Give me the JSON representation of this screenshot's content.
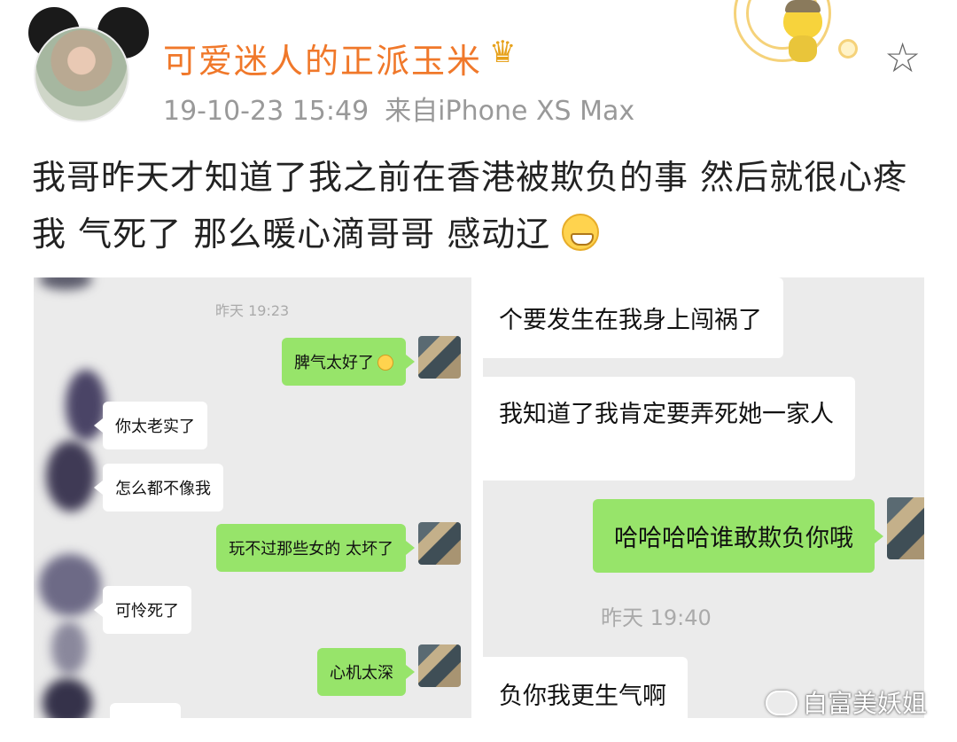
{
  "header": {
    "username": "可爱迷人的正派玉米",
    "crown_glyph": "♛",
    "time": "19-10-23 15:49",
    "source": "来自iPhone XS Max",
    "star_icon": "star-outline-icon"
  },
  "post": {
    "text": "我哥昨天才知道了我之前在香港被欺负的事 然后就很心疼我 气死了 那么暖心滴哥哥 感动辽",
    "emoji": "grin-emoji"
  },
  "left_chat": {
    "timestamp": "昨天 19:23",
    "messages": [
      {
        "side": "right",
        "text": "脾气太好了"
      },
      {
        "side": "left",
        "text": "你太老实了"
      },
      {
        "side": "left",
        "text": "怎么都不像我"
      },
      {
        "side": "right",
        "text": "玩不过那些女的 太坏了"
      },
      {
        "side": "left",
        "text": "可怜死了"
      },
      {
        "side": "right",
        "text": "心机太深"
      }
    ]
  },
  "right_chat": {
    "messages": [
      {
        "side": "left",
        "text": "个要发生在我身上闯祸了"
      },
      {
        "side": "left",
        "text": "我知道了我肯定要弄死她一家人"
      },
      {
        "side": "right",
        "text": "哈哈哈哈谁敢欺负你哦"
      },
      {
        "side": "left",
        "text": "负你我更生气啊"
      }
    ],
    "timestamp": "昨天 19:40"
  },
  "watermark": "白富美妖姐",
  "colors": {
    "username": "#f0782a",
    "green_bubble": "#97e46a",
    "chat_bg": "#ebebeb"
  }
}
